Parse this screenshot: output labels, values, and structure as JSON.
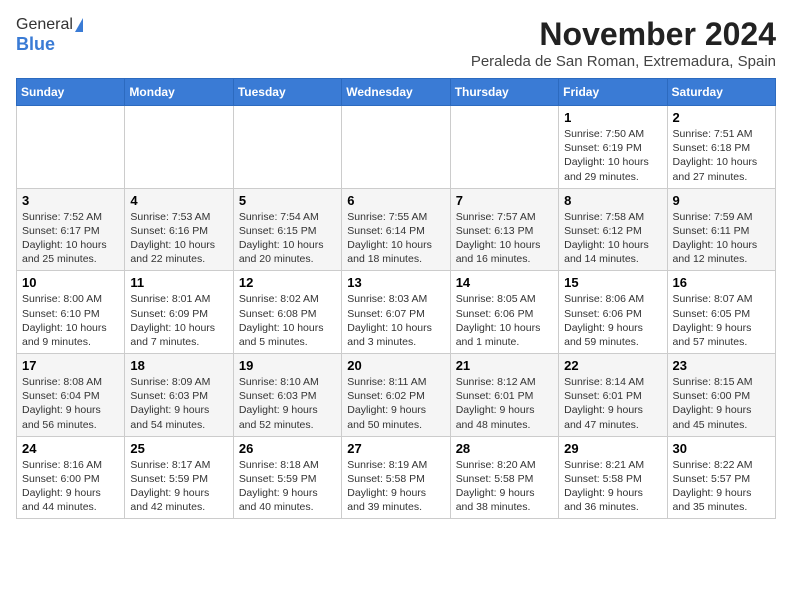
{
  "header": {
    "logo_general": "General",
    "logo_blue": "Blue",
    "month_title": "November 2024",
    "location": "Peraleda de San Roman, Extremadura, Spain"
  },
  "days_of_week": [
    "Sunday",
    "Monday",
    "Tuesday",
    "Wednesday",
    "Thursday",
    "Friday",
    "Saturday"
  ],
  "weeks": [
    [
      {
        "day": "",
        "info": ""
      },
      {
        "day": "",
        "info": ""
      },
      {
        "day": "",
        "info": ""
      },
      {
        "day": "",
        "info": ""
      },
      {
        "day": "",
        "info": ""
      },
      {
        "day": "1",
        "info": "Sunrise: 7:50 AM\nSunset: 6:19 PM\nDaylight: 10 hours and 29 minutes."
      },
      {
        "day": "2",
        "info": "Sunrise: 7:51 AM\nSunset: 6:18 PM\nDaylight: 10 hours and 27 minutes."
      }
    ],
    [
      {
        "day": "3",
        "info": "Sunrise: 7:52 AM\nSunset: 6:17 PM\nDaylight: 10 hours and 25 minutes."
      },
      {
        "day": "4",
        "info": "Sunrise: 7:53 AM\nSunset: 6:16 PM\nDaylight: 10 hours and 22 minutes."
      },
      {
        "day": "5",
        "info": "Sunrise: 7:54 AM\nSunset: 6:15 PM\nDaylight: 10 hours and 20 minutes."
      },
      {
        "day": "6",
        "info": "Sunrise: 7:55 AM\nSunset: 6:14 PM\nDaylight: 10 hours and 18 minutes."
      },
      {
        "day": "7",
        "info": "Sunrise: 7:57 AM\nSunset: 6:13 PM\nDaylight: 10 hours and 16 minutes."
      },
      {
        "day": "8",
        "info": "Sunrise: 7:58 AM\nSunset: 6:12 PM\nDaylight: 10 hours and 14 minutes."
      },
      {
        "day": "9",
        "info": "Sunrise: 7:59 AM\nSunset: 6:11 PM\nDaylight: 10 hours and 12 minutes."
      }
    ],
    [
      {
        "day": "10",
        "info": "Sunrise: 8:00 AM\nSunset: 6:10 PM\nDaylight: 10 hours and 9 minutes."
      },
      {
        "day": "11",
        "info": "Sunrise: 8:01 AM\nSunset: 6:09 PM\nDaylight: 10 hours and 7 minutes."
      },
      {
        "day": "12",
        "info": "Sunrise: 8:02 AM\nSunset: 6:08 PM\nDaylight: 10 hours and 5 minutes."
      },
      {
        "day": "13",
        "info": "Sunrise: 8:03 AM\nSunset: 6:07 PM\nDaylight: 10 hours and 3 minutes."
      },
      {
        "day": "14",
        "info": "Sunrise: 8:05 AM\nSunset: 6:06 PM\nDaylight: 10 hours and 1 minute."
      },
      {
        "day": "15",
        "info": "Sunrise: 8:06 AM\nSunset: 6:06 PM\nDaylight: 9 hours and 59 minutes."
      },
      {
        "day": "16",
        "info": "Sunrise: 8:07 AM\nSunset: 6:05 PM\nDaylight: 9 hours and 57 minutes."
      }
    ],
    [
      {
        "day": "17",
        "info": "Sunrise: 8:08 AM\nSunset: 6:04 PM\nDaylight: 9 hours and 56 minutes."
      },
      {
        "day": "18",
        "info": "Sunrise: 8:09 AM\nSunset: 6:03 PM\nDaylight: 9 hours and 54 minutes."
      },
      {
        "day": "19",
        "info": "Sunrise: 8:10 AM\nSunset: 6:03 PM\nDaylight: 9 hours and 52 minutes."
      },
      {
        "day": "20",
        "info": "Sunrise: 8:11 AM\nSunset: 6:02 PM\nDaylight: 9 hours and 50 minutes."
      },
      {
        "day": "21",
        "info": "Sunrise: 8:12 AM\nSunset: 6:01 PM\nDaylight: 9 hours and 48 minutes."
      },
      {
        "day": "22",
        "info": "Sunrise: 8:14 AM\nSunset: 6:01 PM\nDaylight: 9 hours and 47 minutes."
      },
      {
        "day": "23",
        "info": "Sunrise: 8:15 AM\nSunset: 6:00 PM\nDaylight: 9 hours and 45 minutes."
      }
    ],
    [
      {
        "day": "24",
        "info": "Sunrise: 8:16 AM\nSunset: 6:00 PM\nDaylight: 9 hours and 44 minutes."
      },
      {
        "day": "25",
        "info": "Sunrise: 8:17 AM\nSunset: 5:59 PM\nDaylight: 9 hours and 42 minutes."
      },
      {
        "day": "26",
        "info": "Sunrise: 8:18 AM\nSunset: 5:59 PM\nDaylight: 9 hours and 40 minutes."
      },
      {
        "day": "27",
        "info": "Sunrise: 8:19 AM\nSunset: 5:58 PM\nDaylight: 9 hours and 39 minutes."
      },
      {
        "day": "28",
        "info": "Sunrise: 8:20 AM\nSunset: 5:58 PM\nDaylight: 9 hours and 38 minutes."
      },
      {
        "day": "29",
        "info": "Sunrise: 8:21 AM\nSunset: 5:58 PM\nDaylight: 9 hours and 36 minutes."
      },
      {
        "day": "30",
        "info": "Sunrise: 8:22 AM\nSunset: 5:57 PM\nDaylight: 9 hours and 35 minutes."
      }
    ]
  ]
}
